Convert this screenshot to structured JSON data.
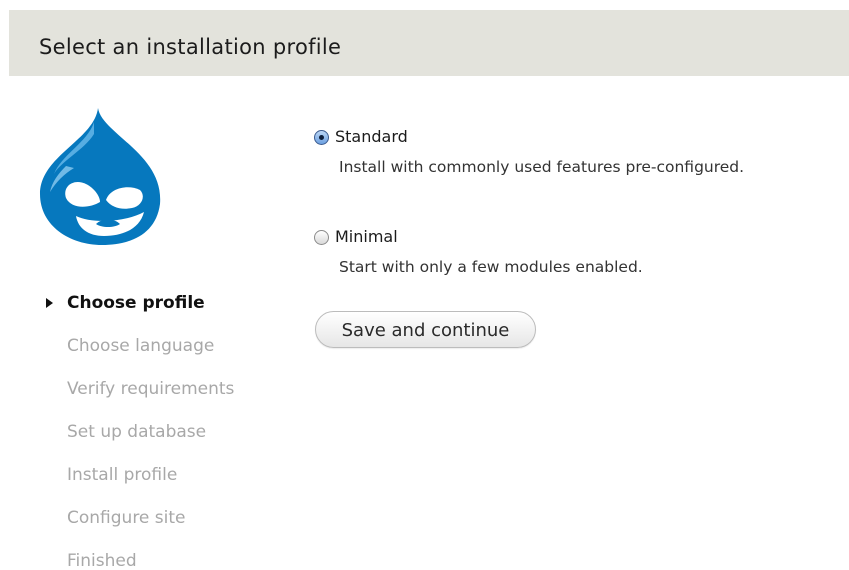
{
  "page": {
    "title": "Select an installation profile"
  },
  "logo": {
    "icon": "drupal-drop-logo",
    "color": "#0678be"
  },
  "steps": [
    {
      "label": "Choose profile",
      "active": true
    },
    {
      "label": "Choose language",
      "active": false
    },
    {
      "label": "Verify requirements",
      "active": false
    },
    {
      "label": "Set up database",
      "active": false
    },
    {
      "label": "Install profile",
      "active": false
    },
    {
      "label": "Configure site",
      "active": false
    },
    {
      "label": "Finished",
      "active": false
    }
  ],
  "profiles": {
    "selected": "Standard",
    "options": [
      {
        "label": "Standard",
        "description": "Install with commonly used features pre-configured.",
        "checked": true
      },
      {
        "label": "Minimal",
        "description": "Start with only a few modules enabled.",
        "checked": false
      }
    ]
  },
  "actions": {
    "save_label": "Save and continue"
  },
  "colors": {
    "header_background": "#e3e3dc",
    "inactive_step": "#a8a8a8",
    "brand_blue": "#0678be"
  }
}
